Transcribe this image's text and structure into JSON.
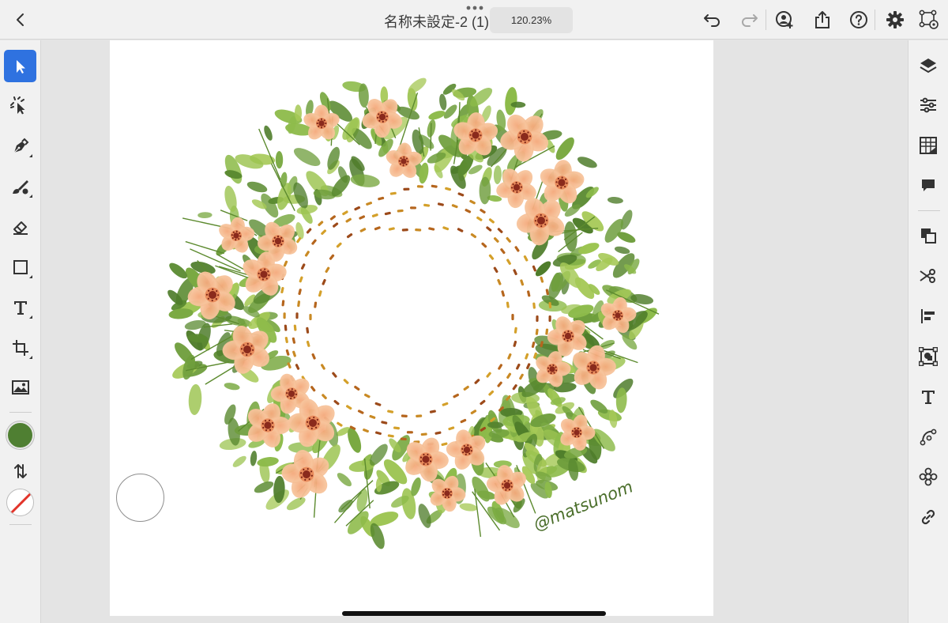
{
  "document": {
    "title": "名称未設定-2 (1)",
    "zoom": "120.23%"
  },
  "signature": "@matsunom",
  "colors": {
    "accent": "#2f72e0",
    "fill": "#4f7f32",
    "stroke": "none"
  },
  "topbar_icons": [
    "back-icon",
    "more-dots-icon",
    "undo-icon",
    "redo-icon",
    "invite-user-icon",
    "share-icon",
    "help-icon",
    "settings-icon",
    "cloud-sync-icon"
  ],
  "left_tools": [
    "selection-tool",
    "direct-selection-tool",
    "pen-tool",
    "brush-tool",
    "eraser-tool",
    "rectangle-tool",
    "type-tool",
    "crop-transform-tool",
    "image-place-tool",
    "fill-color-swatch",
    "swap-colors",
    "stroke-color-swatch"
  ],
  "right_panel": [
    "layers-icon",
    "properties-icon",
    "appearance-grid-icon",
    "comments-icon",
    "arrange-icon",
    "cut-icon",
    "align-icon",
    "pathfinder-icon",
    "type-panel-icon",
    "path-icon",
    "repeat-icon",
    "link-icon"
  ]
}
